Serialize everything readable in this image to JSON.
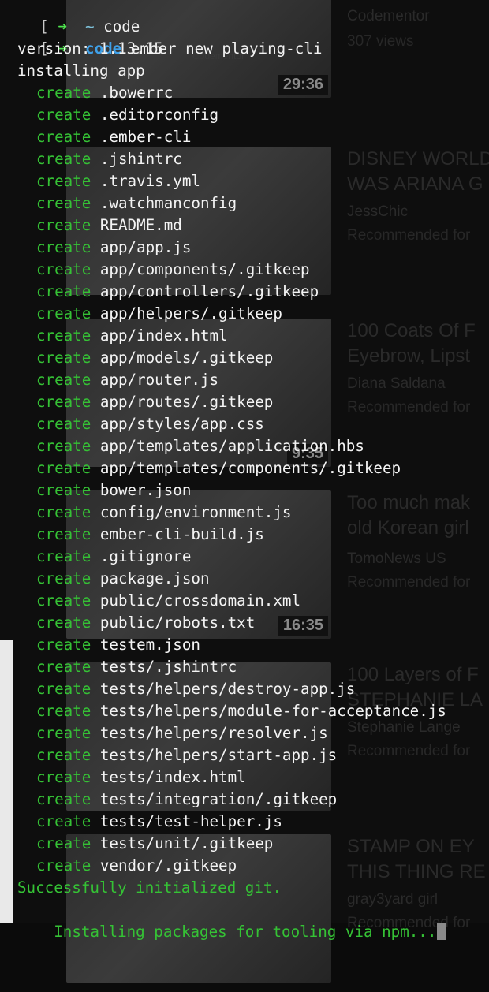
{
  "sidebar": {
    "items": [
      {
        "duration": "29:36",
        "channel": "Codementor",
        "meta": "307 views",
        "thumb_label": "Codementor"
      },
      {
        "title_line1": "DISNEY WORLD",
        "title_line2": "WAS ARIANA G",
        "channel": "JessChic",
        "meta": "Recommended for"
      },
      {
        "duration": "9:35",
        "title_line1": "100 Coats Of F",
        "title_line2": "Eyebrow, Lipst",
        "channel": "Diana Saldana",
        "meta": "Recommended for"
      },
      {
        "duration": "16:35",
        "title_line1": "Too much mak",
        "title_line2": "old Korean girl",
        "channel": "TomoNews US",
        "meta": "Recommended for"
      },
      {
        "title_line1": "100 Layers of F",
        "title_line2": "STEPHANIE LA",
        "channel": "Stephanie Lange",
        "meta": "Recommended for"
      },
      {
        "title_line1": "STAMP ON EY",
        "title_line2": "THIS THING RE",
        "channel": "gray3yard girl",
        "meta": "Recommended for"
      }
    ]
  },
  "terminal": {
    "prompt_bracket": "[",
    "prompt_arrow": "➜",
    "prev_dir": "~",
    "prev_name": "code",
    "cmd_dir": "code",
    "command": "ember new playing-cli",
    "version_line": "version: 1.13.15",
    "installing_line": "installing app",
    "create_word": "create",
    "created_files": [
      ".bowerrc",
      ".editorconfig",
      ".ember-cli",
      ".jshintrc",
      ".travis.yml",
      ".watchmanconfig",
      "README.md",
      "app/app.js",
      "app/components/.gitkeep",
      "app/controllers/.gitkeep",
      "app/helpers/.gitkeep",
      "app/index.html",
      "app/models/.gitkeep",
      "app/router.js",
      "app/routes/.gitkeep",
      "app/styles/app.css",
      "app/templates/application.hbs",
      "app/templates/components/.gitkeep",
      "bower.json",
      "config/environment.js",
      "ember-cli-build.js",
      ".gitignore",
      "package.json",
      "public/crossdomain.xml",
      "public/robots.txt",
      "testem.json",
      "tests/.jshintrc",
      "tests/helpers/destroy-app.js",
      "tests/helpers/module-for-acceptance.js",
      "tests/helpers/resolver.js",
      "tests/helpers/start-app.js",
      "tests/index.html",
      "tests/integration/.gitkeep",
      "tests/test-helper.js",
      "tests/unit/.gitkeep",
      "vendor/.gitkeep"
    ],
    "success_line": "Successfully initialized git.",
    "npm_line": "Installing packages for tooling via npm..."
  },
  "colors": {
    "background": "#0b0b0b",
    "create_green": "#35c235",
    "arrow_green": "#4ee34e",
    "dir_blue": "#3fa0e8",
    "text": "#f2f2f2"
  }
}
